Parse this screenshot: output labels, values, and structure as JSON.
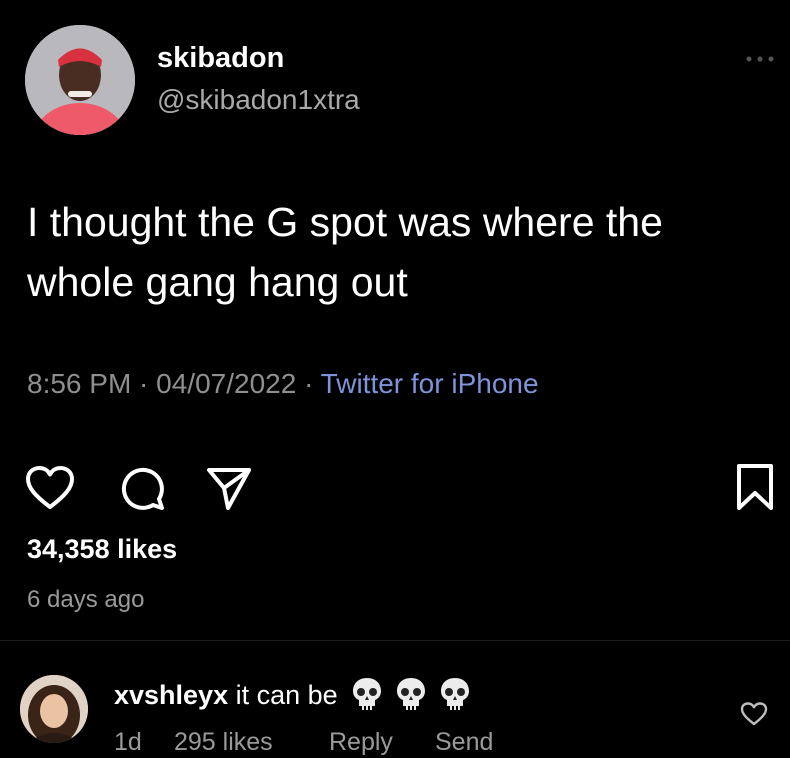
{
  "post": {
    "display_name": "skibadon",
    "handle": "@skibadon1xtra",
    "text": "I thought the G spot was where the whole gang hang out",
    "meta_time_date": "8:56 PM · 04/07/2022 · ",
    "meta_source": "Twitter for iPhone",
    "likes": "34,358 likes",
    "age": "6 days ago"
  },
  "icons": {
    "more": "more-dots-icon",
    "like": "heart-icon",
    "comment": "comment-icon",
    "share": "paper-plane-icon",
    "save": "bookmark-icon",
    "comment_like": "heart-icon",
    "emoji": "skull-icon"
  },
  "comment": {
    "user": "xvshleyx",
    "text": " it can be ",
    "emoji_count": 3,
    "time": "1d",
    "likes": "295 likes",
    "reply_label": "Reply",
    "send_label": "Send"
  },
  "colors": {
    "background": "#000000",
    "source_link": "#7e93d9",
    "muted_text": "#8f8f8f"
  }
}
